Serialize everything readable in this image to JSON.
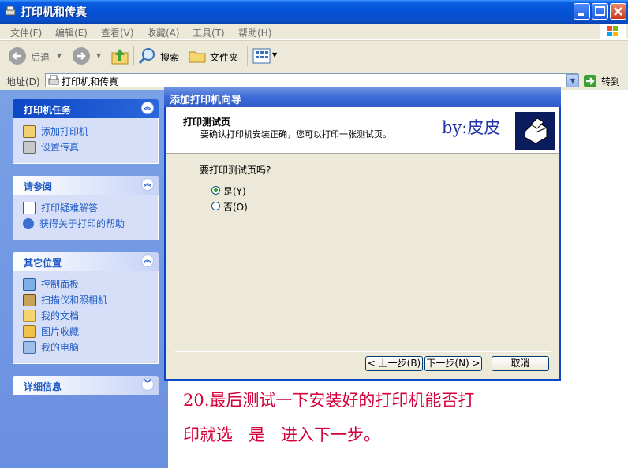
{
  "window": {
    "title": "打印机和传真"
  },
  "menu": [
    "文件(F)",
    "编辑(E)",
    "查看(V)",
    "收藏(A)",
    "工具(T)",
    "帮助(H)"
  ],
  "toolbar": {
    "back": "后退",
    "search": "搜索",
    "folders": "文件夹"
  },
  "address": {
    "label": "地址(D)",
    "value": "打印机和传真",
    "go": "转到"
  },
  "left_panel": {
    "tasks": {
      "title": "打印机任务",
      "items": [
        "添加打印机",
        "设置传真"
      ]
    },
    "see_also": {
      "title": "请参阅",
      "items": [
        "打印疑难解答",
        "获得关于打印的帮助"
      ]
    },
    "other_places": {
      "title": "其它位置",
      "items": [
        "控制面板",
        "扫描仪和照相机",
        "我的文档",
        "图片收藏",
        "我的电脑"
      ]
    },
    "details": {
      "title": "详细信息"
    }
  },
  "wizard": {
    "title": "添加打印机向导",
    "heading": "打印测试页",
    "subheading": "要确认打印机安装正确，您可以打印一张测试页。",
    "watermark": "by:皮皮",
    "question": "要打印测试页吗?",
    "options": [
      {
        "label": "是(Y)",
        "selected": true
      },
      {
        "label": "否(O)",
        "selected": false
      }
    ],
    "back_button": "< 上一步(B)",
    "next_button": "下一步(N) >",
    "cancel_button": "取消"
  },
  "caption": {
    "line1": "20.最后测试一下安装好的打印机能否打",
    "line2": "印就选   是   进入下一步。"
  }
}
